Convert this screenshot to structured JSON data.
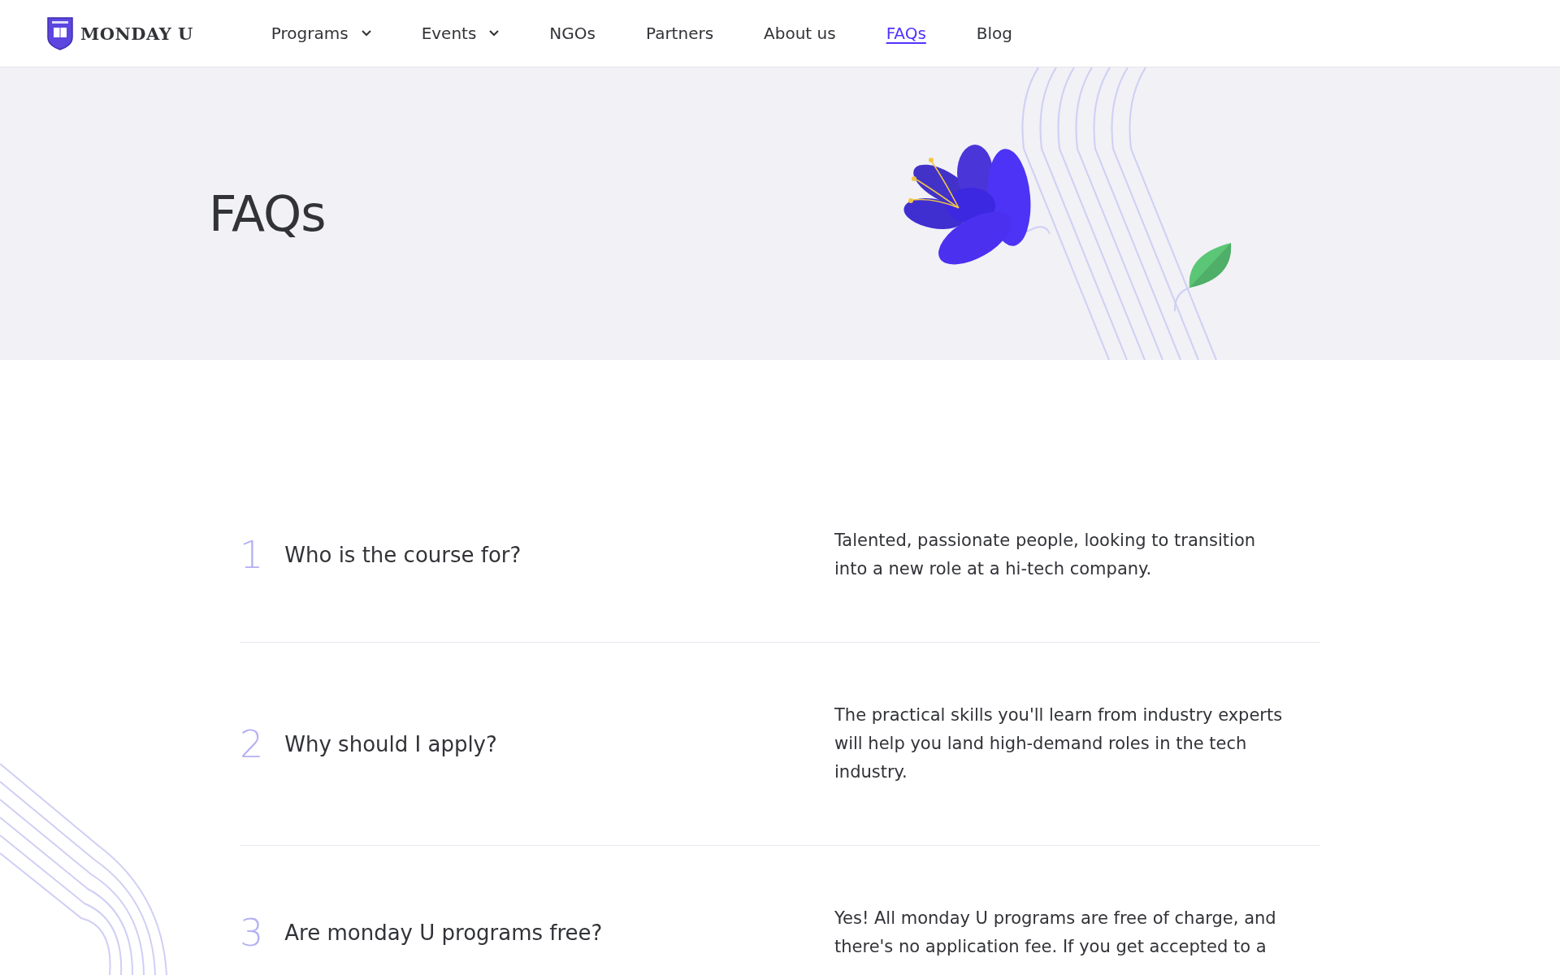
{
  "header": {
    "logo": {
      "wordmark": "MONDAY U"
    },
    "nav": [
      {
        "label": "Programs",
        "dropdown": true,
        "selected": false
      },
      {
        "label": "Events",
        "dropdown": true,
        "selected": false
      },
      {
        "label": "NGOs",
        "dropdown": false,
        "selected": false
      },
      {
        "label": "Partners",
        "dropdown": false,
        "selected": false
      },
      {
        "label": "About us",
        "dropdown": false,
        "selected": false
      },
      {
        "label": "FAQs",
        "dropdown": false,
        "selected": true
      },
      {
        "label": "Blog",
        "dropdown": false,
        "selected": false
      }
    ]
  },
  "hero": {
    "title": "FAQs"
  },
  "faqs": [
    {
      "number": "1",
      "question": "Who is the course for?",
      "answer": "Talented, passionate people, looking to transition into a new role at a hi-tech company."
    },
    {
      "number": "2",
      "question": "Why should I apply?",
      "answer": "The practical skills you'll learn from industry experts will help you land high-demand roles in the tech industry."
    },
    {
      "number": "3",
      "question": "Are monday U programs free?",
      "answer": "Yes! All monday U programs are free of charge, and there's no application fee. If you get accepted to a"
    }
  ]
}
